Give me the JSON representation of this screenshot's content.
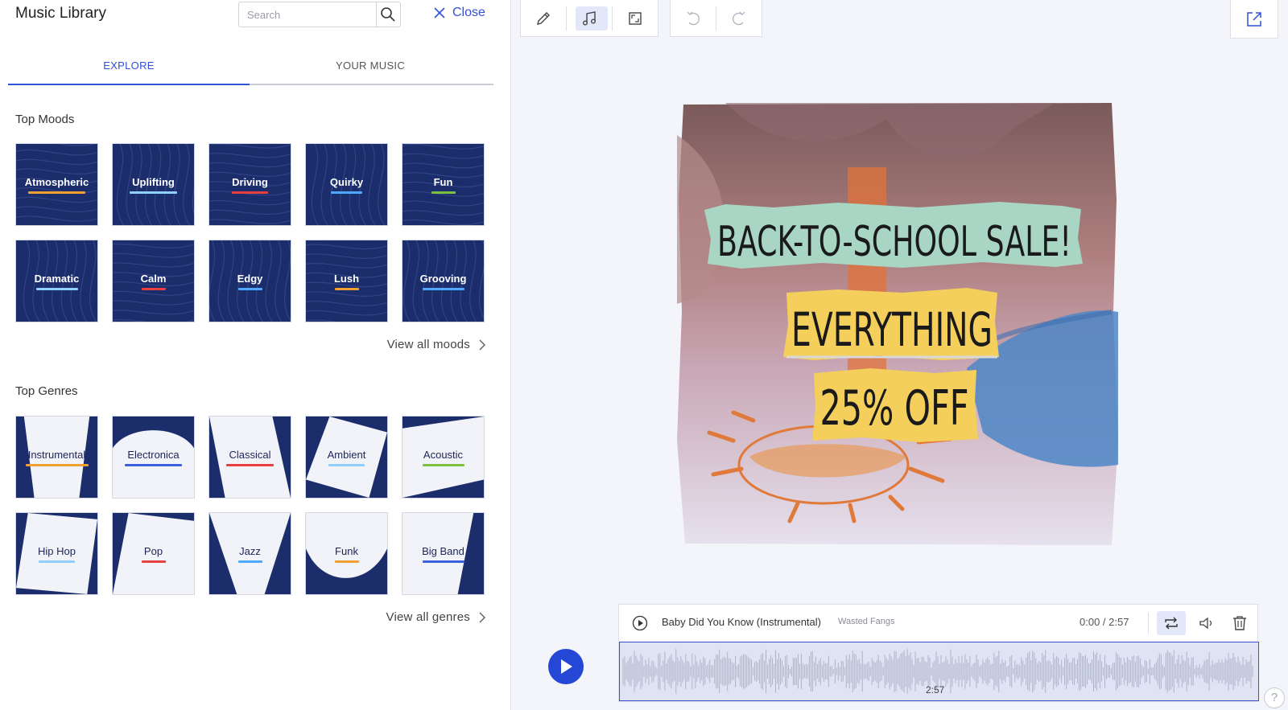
{
  "library": {
    "title": "Music Library",
    "search_placeholder": "Search",
    "close_label": "Close",
    "tabs": [
      {
        "label": "EXPLORE",
        "active": true
      },
      {
        "label": "YOUR MUSIC",
        "active": false
      }
    ],
    "moods_title": "Top Moods",
    "moods": [
      {
        "label": "Atmospheric",
        "accent": "#f0a030"
      },
      {
        "label": "Uplifting",
        "accent": "#8fd0ff"
      },
      {
        "label": "Driving",
        "accent": "#e84040"
      },
      {
        "label": "Quirky",
        "accent": "#4fa8ff"
      },
      {
        "label": "Fun",
        "accent": "#7cc040"
      },
      {
        "label": "Dramatic",
        "accent": "#8fd0ff"
      },
      {
        "label": "Calm",
        "accent": "#e84040"
      },
      {
        "label": "Edgy",
        "accent": "#4fa8ff"
      },
      {
        "label": "Lush",
        "accent": "#f0a030"
      },
      {
        "label": "Grooving",
        "accent": "#4fa8ff"
      }
    ],
    "view_all_moods": "View all moods",
    "genres_title": "Top Genres",
    "genres": [
      {
        "label": "Instrumental",
        "accent": "#f0a030"
      },
      {
        "label": "Electronica",
        "accent": "#3a5fe0"
      },
      {
        "label": "Classical",
        "accent": "#e84040"
      },
      {
        "label": "Ambient",
        "accent": "#8fd0ff"
      },
      {
        "label": "Acoustic",
        "accent": "#7cc040"
      },
      {
        "label": "Hip Hop",
        "accent": "#8fd0ff"
      },
      {
        "label": "Pop",
        "accent": "#e84040"
      },
      {
        "label": "Jazz",
        "accent": "#4fa8ff"
      },
      {
        "label": "Funk",
        "accent": "#f0a030"
      },
      {
        "label": "Big Band",
        "accent": "#3a5fe0"
      }
    ],
    "view_all_genres": "View all genres"
  },
  "toolbar": {
    "tools": [
      "pencil-icon",
      "music-note-icon",
      "resize-icon"
    ],
    "history": [
      "undo-icon",
      "redo-icon"
    ],
    "share": "share-icon"
  },
  "canvas": {
    "line1": "BACK-TO-SCHOOL SALE!",
    "line2": "EVERYTHING",
    "line3": "25% OFF"
  },
  "player": {
    "track": "Baby Did You Know (Instrumental)",
    "artist": "Wasted Fangs",
    "time": "0:00 / 2:57",
    "duration_label": "2:57"
  },
  "colors": {
    "accent": "#3150d8",
    "tile_bg": "#1c2d6b",
    "play_button": "#2547d6"
  },
  "help_label": "?"
}
